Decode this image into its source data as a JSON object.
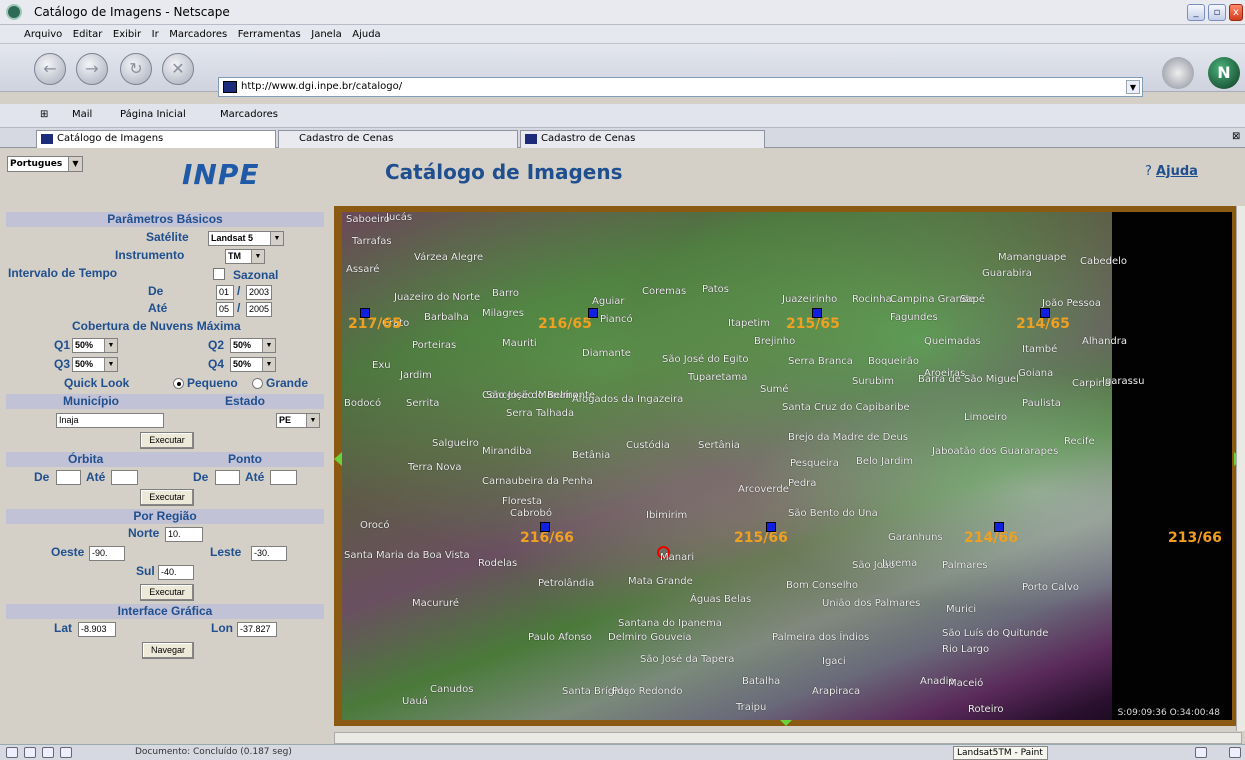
{
  "window": {
    "title": "Catálogo de Imagens - Netscape"
  },
  "menu": [
    "Arquivo",
    "Editar",
    "Exibir",
    "Ir",
    "Marcadores",
    "Ferramentas",
    "Janela",
    "Ajuda"
  ],
  "address": {
    "url": "http://www.dgi.inpe.br/catalogo/"
  },
  "bookmarks": {
    "mail": "Mail",
    "home": "Página Inicial",
    "marks": "Marcadores"
  },
  "tabs": [
    "Catálogo de Imagens",
    "Cadastro de Cenas",
    "Cadastro de Cenas"
  ],
  "header": {
    "language": "Portugues",
    "logo": "INPE",
    "title": "Catálogo de Imagens",
    "help_prefix": "?",
    "help": "Ajuda"
  },
  "form": {
    "basic_title": "Parâmetros Básicos",
    "satellite_label": "Satélite",
    "satellite": "Landsat 5",
    "instrument_label": "Instrumento",
    "instrument": "TM",
    "interval_label": "Intervalo de Tempo",
    "seasonal_label": "Sazonal",
    "from_label": "De",
    "from_month": "01",
    "from_year": "2003",
    "to_label": "Até",
    "to_month": "05",
    "to_year": "2005",
    "slash": "/",
    "clouds_title": "Cobertura de Nuvens Máxima",
    "q1_label": "Q1",
    "q1": "50%",
    "q2_label": "Q2",
    "q2": "50%",
    "q3_label": "Q3",
    "q3": "50%",
    "q4_label": "Q4",
    "q4": "50%",
    "quicklook_label": "Quick Look",
    "small": "Pequeno",
    "large": "Grande",
    "municipio_label": "Município",
    "estado_label": "Estado",
    "municipio": "Inaja",
    "estado": "PE",
    "execute": "Executar",
    "orbit_label": "Órbita",
    "point_label": "Ponto",
    "de_label": "De",
    "ate_label": "Até",
    "region_title": "Por Região",
    "north_label": "Norte",
    "north": "10.",
    "west_label": "Oeste",
    "west": "-90.",
    "east_label": "Leste",
    "east": "-30.",
    "south_label": "Sul",
    "south": "-40.",
    "interface_title": "Interface Gráfica",
    "lat_label": "Lat",
    "lat": "-8.903",
    "lon_label": "Lon",
    "lon": "-37.827",
    "navigate": "Navegar"
  },
  "map": {
    "towns": [
      "Saboeiro",
      "Jucás",
      "Tarrafas",
      "Várzea Alegre",
      "Assaré",
      "Juazeiro do Norte",
      "Barro",
      "Aguiar",
      "Coremas",
      "Patos",
      "Juazeirinho",
      "Rocinha",
      "Campina Grande",
      "Sapé",
      "João Pessoa",
      "Crato",
      "Barbalha",
      "Milagres",
      "Piancó",
      "Itapetim",
      "Fagundes",
      "Guarabira",
      "Mamanguape",
      "Cabedelo",
      "Porteiras",
      "Mauriti",
      "Diamante",
      "Brejinho",
      "Queimadas",
      "Itambé",
      "Alhandra",
      "Exu",
      "Jardim",
      "Conceição",
      "Manaíra",
      "São José do Egito",
      "Tuparetama",
      "Serra Branca",
      "Boqueirão",
      "Barra de São Miguel",
      "Sumé",
      "Surubim",
      "Aroeiras",
      "Goiana",
      "Carpina",
      "Igarassu",
      "Bodocó",
      "Serrita",
      "São José do Belmonte",
      "Serra Talhada",
      "Afogados da Ingazeira",
      "Santa Cruz do Capibaribe",
      "Limoeiro",
      "Paulista",
      "Salgueiro",
      "Mirandiba",
      "Betânia",
      "Custódia",
      "Sertânia",
      "Brejo da Madre de Deus",
      "Jaboatão dos Guararapes",
      "Recife",
      "Terra Nova",
      "Carnaubeira da Penha",
      "Pesqueira",
      "Belo Jardim",
      "Floresta",
      "Pedra",
      "Arcoverde",
      "Cabrobó",
      "Ibimirim",
      "São Bento do Una",
      "Orocó",
      "Santa Maria da Boa Vista",
      "Manari",
      "Garanhuns",
      "São João",
      "Jurema",
      "Palmares",
      "Porto Calvo",
      "Rodelas",
      "Mata Grande",
      "Bom Conselho",
      "Petrolândia",
      "Águas Belas",
      "Santana do Ipanema",
      "União dos Palmares",
      "Murici",
      "Macururé",
      "Paulo Afonso",
      "Delmiro Gouveia",
      "Palmeira dos Índios",
      "São Luís do Quitunde",
      "Rio Largo",
      "Igaci",
      "São José da Tapera",
      "Batalha",
      "Canudos",
      "Santa Brígida",
      "Poço Redondo",
      "Arapiraca",
      "Anadia",
      "Maceió",
      "Traipu",
      "Roteiro",
      "Uauá"
    ],
    "scenes": [
      "217/65",
      "216/65",
      "215/65",
      "214/65",
      "216/66",
      "215/66",
      "214/66",
      "213/66"
    ],
    "sat_time": "S:09:09:36 O:34:00:48"
  },
  "status": {
    "text": "Documento: Concluído (0.187 seg)",
    "task": "Landsat5TM - Paint"
  }
}
